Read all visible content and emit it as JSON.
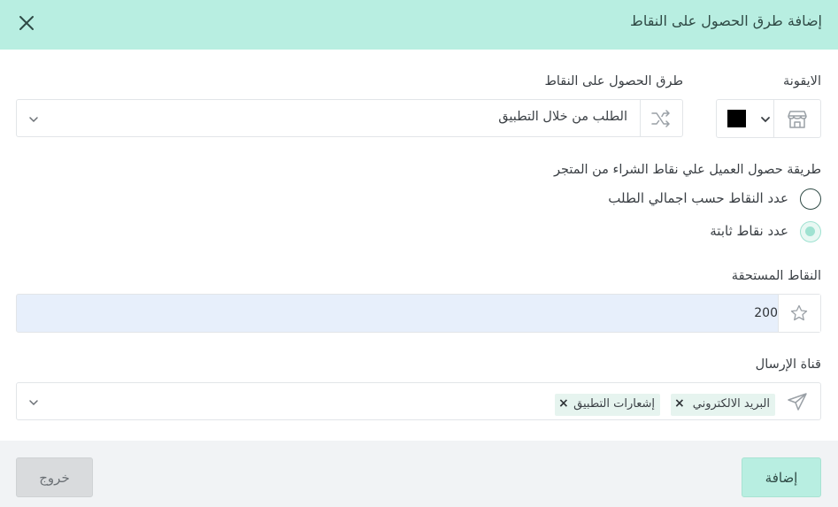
{
  "dialog": {
    "title": "إضافة طرق الحصول على النقاط"
  },
  "form": {
    "icon_label": "الايقونة",
    "icon_name": "store-icon",
    "selected_color": "#000000",
    "method_label": "طرق الحصول على النقاط",
    "method_value": "الطلب من خلال التطبيق",
    "calc_label": "طريقة حصول العميل علي نقاط الشراء من المتجر",
    "radio_options": [
      {
        "label": "عدد النقاط حسب اجمالي الطلب",
        "checked": false
      },
      {
        "label": "عدد نقاط ثابتة",
        "checked": true
      }
    ],
    "points_label": "النقاط المستحقة",
    "points_value": "200",
    "channel_label": "قناة الإرسال",
    "channels": [
      {
        "label": "البريد الالكتروني"
      },
      {
        "label": "إشعارات التطبيق"
      }
    ]
  },
  "footer": {
    "add_label": "إضافة",
    "exit_label": "خروج"
  },
  "colors": {
    "accent": "#b8eee1",
    "radio_checked": "#9fe2d1",
    "input_fill": "#e7effb",
    "chip_bg": "#e6f4ef"
  }
}
